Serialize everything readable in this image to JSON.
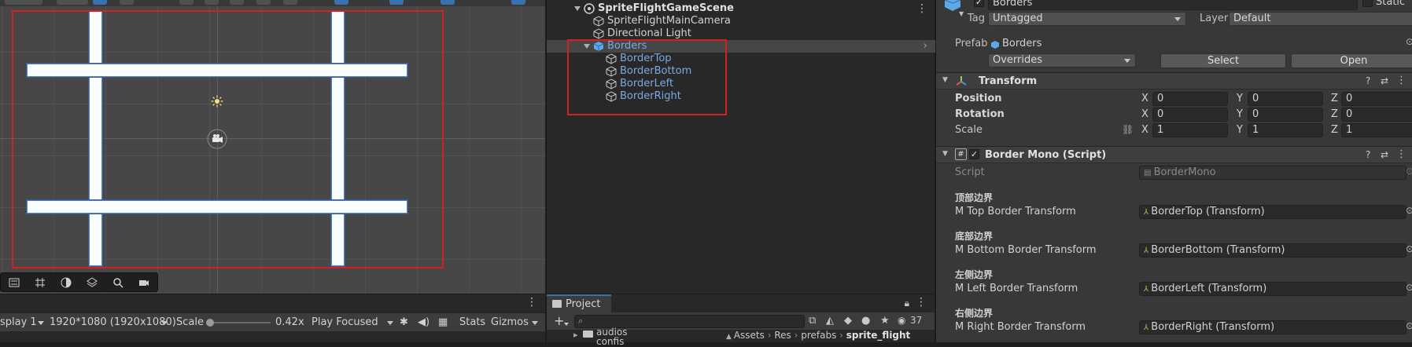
{
  "scene": {
    "overlay_icons": [
      "tool-settings-icon",
      "grid-icon",
      "orientation-icon",
      "layers-icon",
      "search-icon",
      "camera-icon"
    ]
  },
  "game_view": {
    "display_label": "splay 1",
    "resolution_label": "1920*1080 (1920x1080)",
    "scale_label": "Scale",
    "scale_value": "0.42x",
    "scale_slider_fraction": 0.0,
    "play_mode_label": "Play Focused",
    "stats_label": "Stats",
    "gizmos_label": "Gizmos"
  },
  "hierarchy": {
    "scene_name": "SpriteFlightGameScene",
    "items": [
      {
        "label": "SpriteFlightMainCamera"
      },
      {
        "label": "Directional Light"
      },
      {
        "label": "Borders"
      },
      {
        "label": "BorderTop"
      },
      {
        "label": "BorderBottom"
      },
      {
        "label": "BorderLeft"
      },
      {
        "label": "BorderRight"
      }
    ]
  },
  "project": {
    "tab_label": "Project",
    "search_placeholder": "",
    "hidden_count": "37",
    "folders": [
      "audios",
      "confis"
    ],
    "breadcrumb": [
      "Assets",
      "Res",
      "prefabs",
      "sprite_flight"
    ]
  },
  "inspector": {
    "object_name": "Borders",
    "static_label": "Static",
    "tag_label": "Tag",
    "tag_value": "Untagged",
    "layer_label": "Layer",
    "layer_value": "Default",
    "prefab_label": "Prefab",
    "prefab_value": "Borders",
    "overrides_label": "Overrides",
    "select_label": "Select",
    "open_label": "Open",
    "transform": {
      "title": "Transform",
      "position_label": "Position",
      "rotation_label": "Rotation",
      "scale_label": "Scale",
      "axis_x": "X",
      "axis_y": "Y",
      "axis_z": "Z",
      "position": [
        "0",
        "0",
        "0"
      ],
      "rotation": [
        "0",
        "0",
        "0"
      ],
      "scale": [
        "1",
        "1",
        "1"
      ]
    },
    "script_component": {
      "title": "Border Mono (Script)",
      "script_label": "Script",
      "script_value": "BorderMono",
      "fields": [
        {
          "header": "顶部边界",
          "label": "M Top Border Transform",
          "value": "BorderTop (Transform)"
        },
        {
          "header": "底部边界",
          "label": "M Bottom Border Transform",
          "value": "BorderBottom (Transform)"
        },
        {
          "header": "左侧边界",
          "label": "M Left Border Transform",
          "value": "BorderLeft (Transform)"
        },
        {
          "header": "右侧边界",
          "label": "M Right Border Transform",
          "value": "BorderRight (Transform)"
        }
      ]
    }
  },
  "colors": {
    "selection_highlight": "#d42020",
    "prefab_blue": "#7ea7e6",
    "accent_tab": "#3a72b0"
  }
}
